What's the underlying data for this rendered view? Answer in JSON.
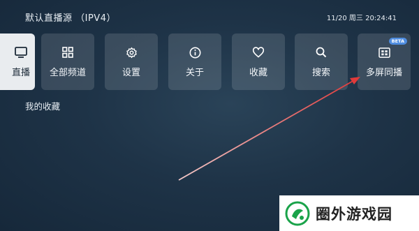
{
  "header": {
    "source_title": "默认直播源 （IPV4）",
    "datetime": "11/20 周三 20:24:41"
  },
  "tiles": [
    {
      "label": "直播",
      "icon": "tv-icon",
      "active": true
    },
    {
      "label": "全部频道",
      "icon": "grid-icon"
    },
    {
      "label": "设置",
      "icon": "gear-icon"
    },
    {
      "label": "关于",
      "icon": "info-icon"
    },
    {
      "label": "收藏",
      "icon": "heart-icon"
    },
    {
      "label": "搜索",
      "icon": "search-icon"
    },
    {
      "label": "多屏同播",
      "icon": "multiscreen-icon",
      "badge": "BETA"
    }
  ],
  "section": {
    "favorites_title": "我的收藏"
  },
  "watermark": {
    "text": "圈外游戏园"
  },
  "colors": {
    "accent": "#4f8de0",
    "arrow": "#e03a3a",
    "active_tile": "#e9ecef"
  }
}
